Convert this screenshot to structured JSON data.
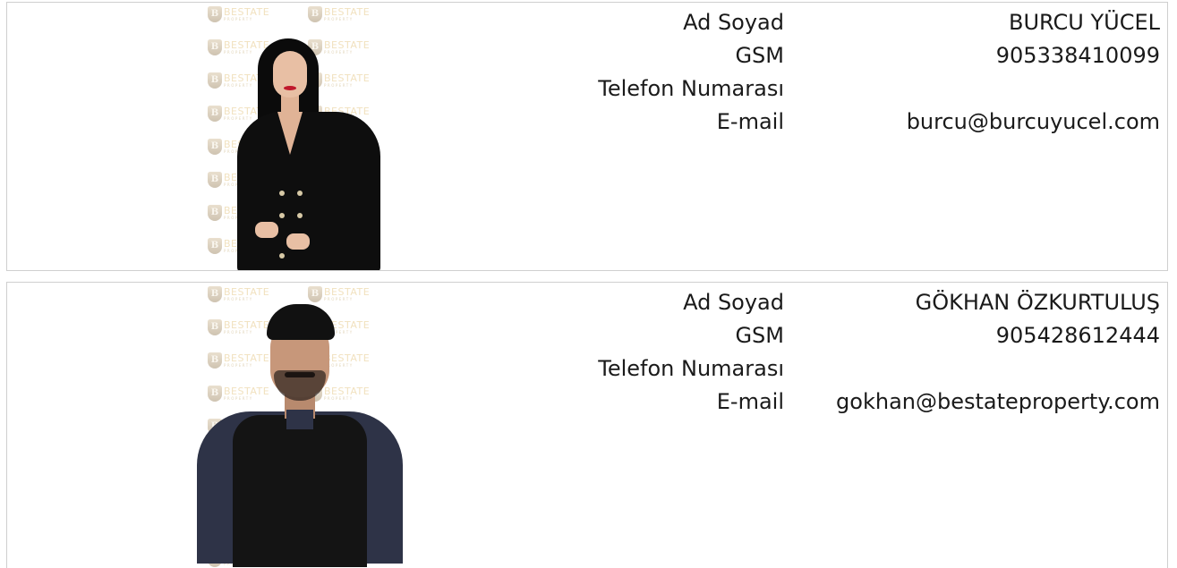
{
  "watermark": {
    "brand": "BESTATE",
    "sub": "PROPERTY",
    "shield_letter": "B",
    "accent_color": "#e7c98a"
  },
  "agents": [
    {
      "fields": [
        {
          "label": "Ad Soyad",
          "value": "BURCU YÜCEL"
        },
        {
          "label": "GSM",
          "value": "905338410099"
        },
        {
          "label": "Telefon Numarası",
          "value": ""
        },
        {
          "label": "E-mail",
          "value": "burcu@burcuyucel.com"
        }
      ]
    },
    {
      "fields": [
        {
          "label": "Ad Soyad",
          "value": "GÖKHAN ÖZKURTULUŞ"
        },
        {
          "label": "GSM",
          "value": "905428612444"
        },
        {
          "label": "Telefon Numarası",
          "value": ""
        },
        {
          "label": "E-mail",
          "value": "gokhan@bestateproperty.com"
        }
      ]
    }
  ]
}
